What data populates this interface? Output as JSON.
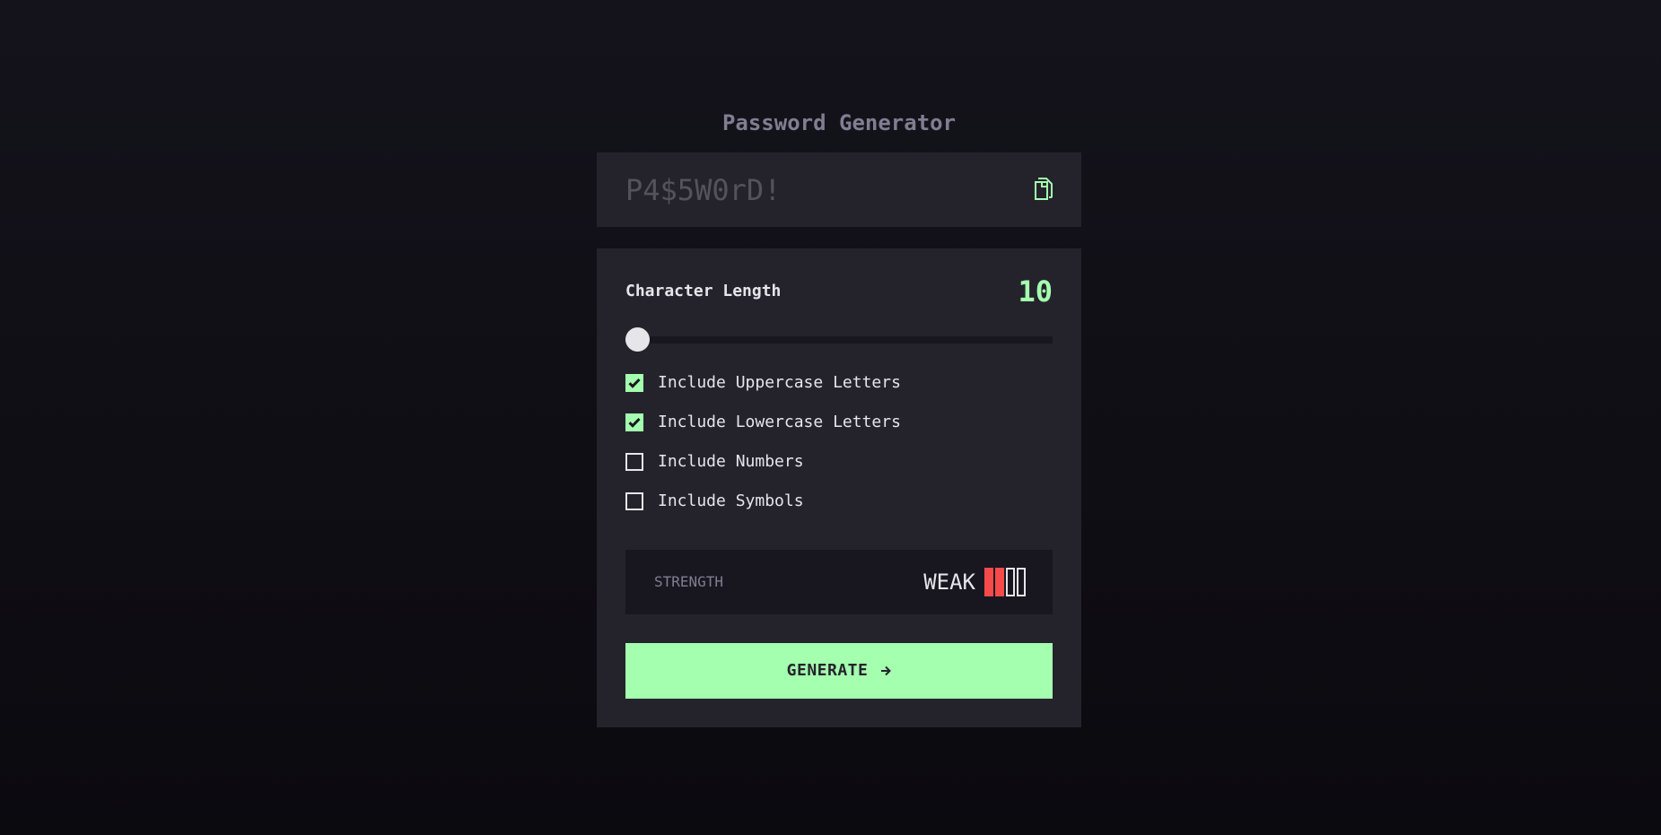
{
  "app": {
    "title": "Password Generator"
  },
  "password": {
    "value": "P4$5W0rD!",
    "copy_icon": "copy-icon"
  },
  "length": {
    "label": "Character Length",
    "value": "10",
    "slider_fraction": 0
  },
  "options": [
    {
      "label": "Include Uppercase Letters",
      "checked": true
    },
    {
      "label": "Include Lowercase Letters",
      "checked": true
    },
    {
      "label": "Include Numbers",
      "checked": false
    },
    {
      "label": "Include Symbols",
      "checked": false
    }
  ],
  "strength": {
    "label": "STRENGTH",
    "level_text": "WEAK",
    "level": 2,
    "max_level": 4
  },
  "generate": {
    "label": "GENERATE",
    "icon": "arrow-right-icon"
  },
  "colors": {
    "accent": "#a4ffaf",
    "weak": "#f64a4a",
    "panel": "#24232c",
    "dark": "#18171f"
  }
}
